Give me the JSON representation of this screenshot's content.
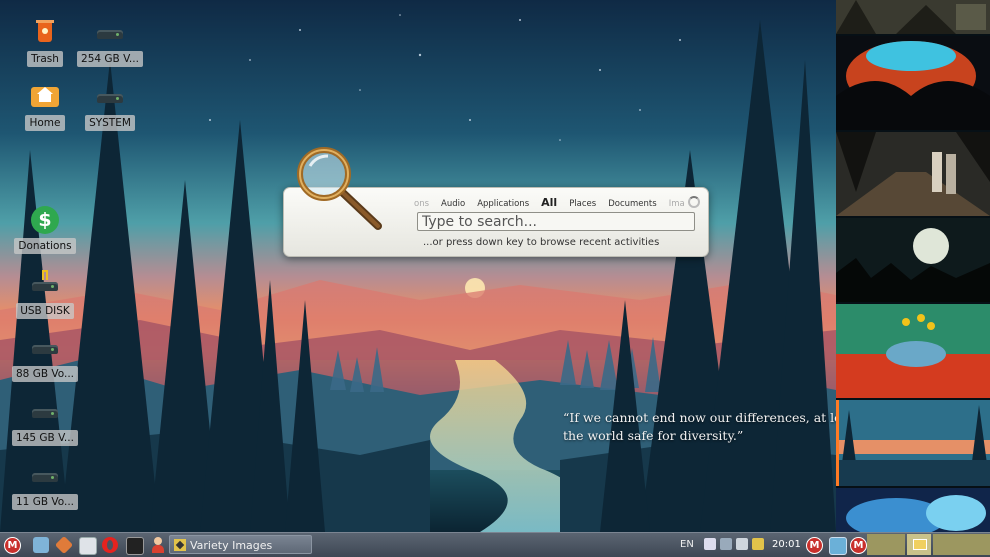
{
  "desktop": {
    "icons": [
      {
        "label": "Trash",
        "icon": "trash-icon"
      },
      {
        "label": "254 GB V...",
        "icon": "drive-icon"
      },
      {
        "label": "Home",
        "icon": "home-folder-icon"
      },
      {
        "label": "SYSTEM",
        "icon": "drive-icon"
      },
      {
        "label": "Donations",
        "icon": "dollar-icon"
      },
      {
        "label": "USB DISK",
        "icon": "usb-drive-icon"
      },
      {
        "label": "88 GB Vo...",
        "icon": "drive-icon"
      },
      {
        "label": "145 GB V...",
        "icon": "drive-icon"
      },
      {
        "label": "11 GB Vo...",
        "icon": "drive-icon"
      }
    ]
  },
  "launcher": {
    "tabs": [
      "ons",
      "Audio",
      "Applications",
      "All",
      "Places",
      "Documents",
      "Ima"
    ],
    "active_tab": "All",
    "placeholder": "Type to search...",
    "hint": "...or press down key to browse recent activities"
  },
  "quote": {
    "line1": "“If we cannot end now our differences, at least",
    "line2": "the world safe for diversity.”"
  },
  "taskbar": {
    "task_label": "Variety Images",
    "language": "EN",
    "clock": "20:01",
    "launchers": [
      "mint-menu-icon",
      "show-desktop-icon",
      "package-icon",
      "notes-icon",
      "opera-icon",
      "terminal-icon",
      "user-icon"
    ]
  },
  "colors": {
    "accent_selected_thumb": "#ff7b25",
    "taskbar": "#4b5462",
    "mint_red": "#c9302c"
  }
}
